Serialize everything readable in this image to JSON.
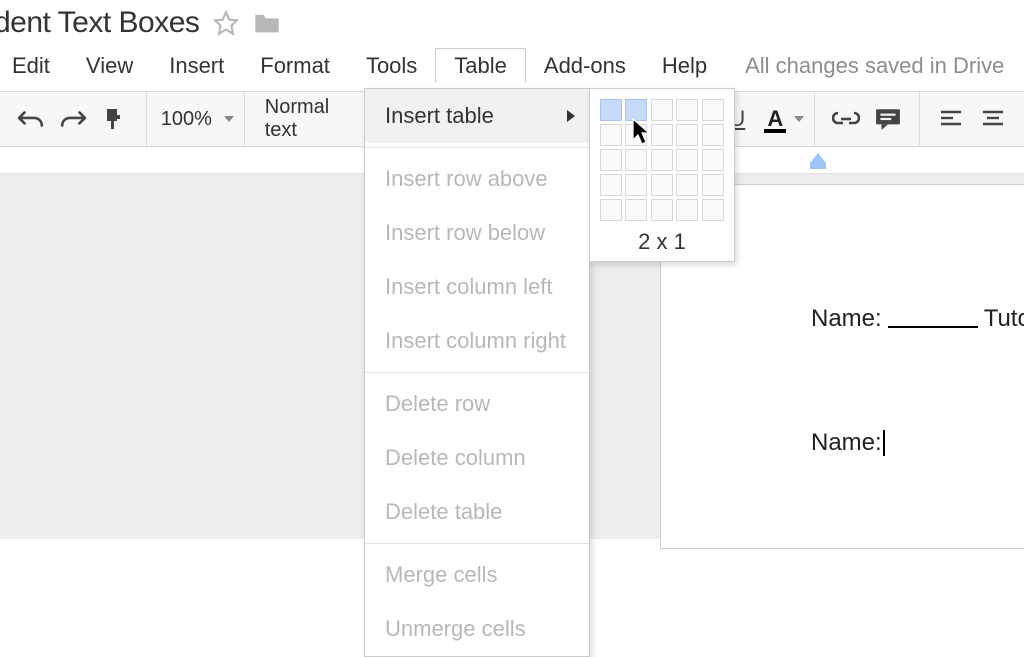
{
  "title": "dent Text Boxes",
  "menu": {
    "edit": "Edit",
    "view": "View",
    "insert": "Insert",
    "format": "Format",
    "tools": "Tools",
    "table": "Table",
    "addons": "Add-ons",
    "help": "Help",
    "save_status": "All changes saved in Drive"
  },
  "toolbar": {
    "zoom": "100%",
    "style": "Normal text",
    "underline_glyph": "U",
    "textcolor_glyph": "A"
  },
  "table_menu": {
    "insert_table": "Insert table",
    "insert_row_above": "Insert row above",
    "insert_row_below": "Insert row below",
    "insert_col_left": "Insert column left",
    "insert_col_right": "Insert column right",
    "delete_row": "Delete row",
    "delete_col": "Delete column",
    "delete_table": "Delete table",
    "merge": "Merge cells",
    "unmerge": "Unmerge cells"
  },
  "size_picker": {
    "label": "2 x 1",
    "cols": 2,
    "rows": 1
  },
  "document": {
    "name_label": "Name:",
    "tutor_label": "Tutor",
    "name_label2": "Name:"
  }
}
